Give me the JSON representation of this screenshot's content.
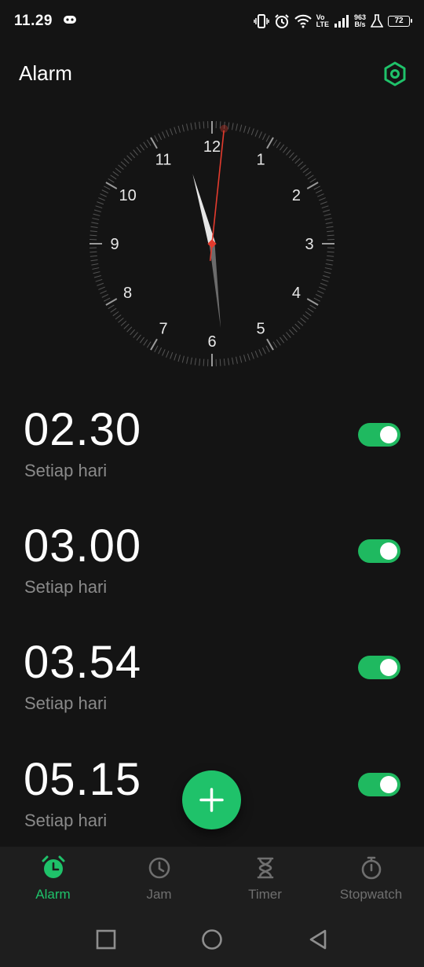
{
  "status_bar": {
    "time": "11.29",
    "net_speed_value": "963",
    "net_speed_unit": "B/s",
    "volte_top": "Vo",
    "volte_bottom": "LTE",
    "battery": "72",
    "icons": [
      "game-controller-icon",
      "vibrate-icon",
      "alarm-status-icon",
      "wifi-icon",
      "volte-icon",
      "signal-icon",
      "flask-icon",
      "battery-icon"
    ]
  },
  "header": {
    "title": "Alarm",
    "settings_icon": "settings-hexagon-icon"
  },
  "clock": {
    "numbers": [
      "12",
      "1",
      "2",
      "3",
      "4",
      "5",
      "6",
      "7",
      "8",
      "9",
      "10",
      "11"
    ],
    "hour": 11,
    "minute": 29,
    "second": 1,
    "accent": "#e33b2e"
  },
  "alarms": [
    {
      "time": "02.30",
      "repeat": "Setiap hari",
      "enabled": true
    },
    {
      "time": "03.00",
      "repeat": "Setiap hari",
      "enabled": true
    },
    {
      "time": "03.54",
      "repeat": "Setiap hari",
      "enabled": true
    },
    {
      "time": "05.15",
      "repeat": "Setiap hari",
      "enabled": true
    }
  ],
  "fab": {
    "icon": "plus-icon"
  },
  "bottom_nav": {
    "items": [
      {
        "label": "Alarm",
        "icon": "alarm-clock-icon",
        "active": true
      },
      {
        "label": "Jam",
        "icon": "clock-icon",
        "active": false
      },
      {
        "label": "Timer",
        "icon": "hourglass-icon",
        "active": false
      },
      {
        "label": "Stopwatch",
        "icon": "stopwatch-icon",
        "active": false
      }
    ]
  },
  "system_nav": {
    "icons": [
      "recents-square-icon",
      "home-circle-icon",
      "back-triangle-icon"
    ]
  },
  "colors": {
    "accent": "#1fc26a",
    "background": "#141414",
    "inactive": "#6f6f6f"
  }
}
